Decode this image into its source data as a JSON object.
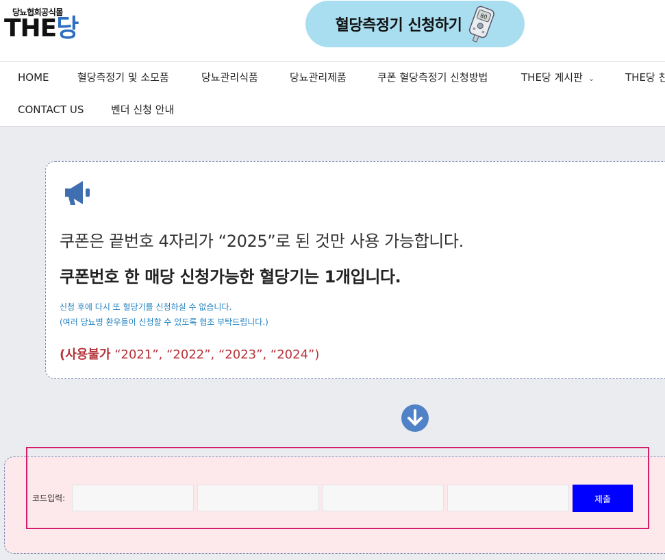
{
  "header": {
    "logo": {
      "top": "당뇨협회공식몰",
      "main": "THE",
      "accent": "당"
    },
    "cta": {
      "label": "혈당측정기 신청하기",
      "icon": "glucose-meter-icon"
    }
  },
  "nav": {
    "items": [
      "HOME",
      "혈당측정기 및 소모품",
      "당뇨관리식품",
      "당뇨관리제품",
      "쿠폰 혈당측정기 신청방법",
      "THE당 게시판",
      "THE당 친",
      "CONTACT US",
      "벤더 신청 안내"
    ]
  },
  "notice": {
    "icon": "megaphone-icon",
    "line1": "쿠폰은 끝번호 4자리가 “2025”로 된 것만 사용 가능합니다.",
    "line2": "쿠폰번호 한 매당 신청가능한 혈당기는 1개입니다.",
    "line3": "신청 후에 다시 또 혈당기를 신청하실 수 없습니다.",
    "line4": "(여러 당뇨병 환우들이 신청할 수 있도록 협조 부탁드립니다.)",
    "line5_strong": "(사용불가",
    "line5_rest": " “2021”, “2022”, “2023”, “2024”)"
  },
  "divider_icon": "arrow-down-circle-icon",
  "form": {
    "label": "코드입력:",
    "inputs": [
      "",
      "",
      "",
      ""
    ],
    "submit": "제출"
  },
  "colors": {
    "cta_bg": "#a9def0",
    "logo_accent": "#2d6fc0",
    "info_text": "#1c7fbf",
    "warn_text": "#b5333a",
    "form_bg": "#fde8ec",
    "highlight_border": "#d41e6c",
    "submit_bg": "#0000ff"
  }
}
